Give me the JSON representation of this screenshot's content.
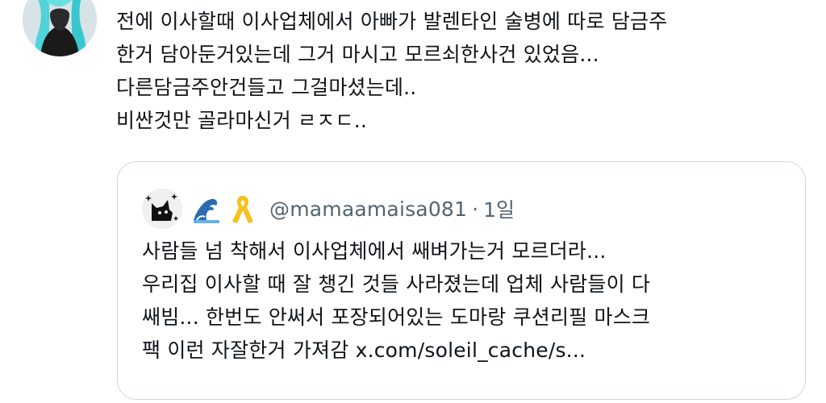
{
  "tweet": {
    "author_avatar": "avatar-icon",
    "text": "전에 이사할때 이사업체에서 아빠가 발렌타인 술병에 따로 담금주\n한거 담아둔거있는데 그거 마시고 모르쇠한사건 있었음...\n다른담금주안건들고 그걸마셨는데..\n비싼것만 골라마신거 ㄹㅈㄷ.."
  },
  "quote": {
    "avatar": "cat-sparkle-avatar-icon",
    "emojis": [
      "wave-emoji",
      "yellow-ribbon-emoji"
    ],
    "handle": "@mamaamaisa081",
    "separator": "·",
    "time": "1일",
    "text": "사람들 넘 착해서 이사업체에서 쌔벼가는거 모르더라...\n우리집 이사할 때 잘 챙긴 것들 사라졌는데 업체 사람들이 다\n쌔빔... 한번도 안써서 포장되어있는 도마랑 쿠션리필 마스크\n팩 이런 자잘한거 가져감 x.com/soleil_cache/s..."
  }
}
